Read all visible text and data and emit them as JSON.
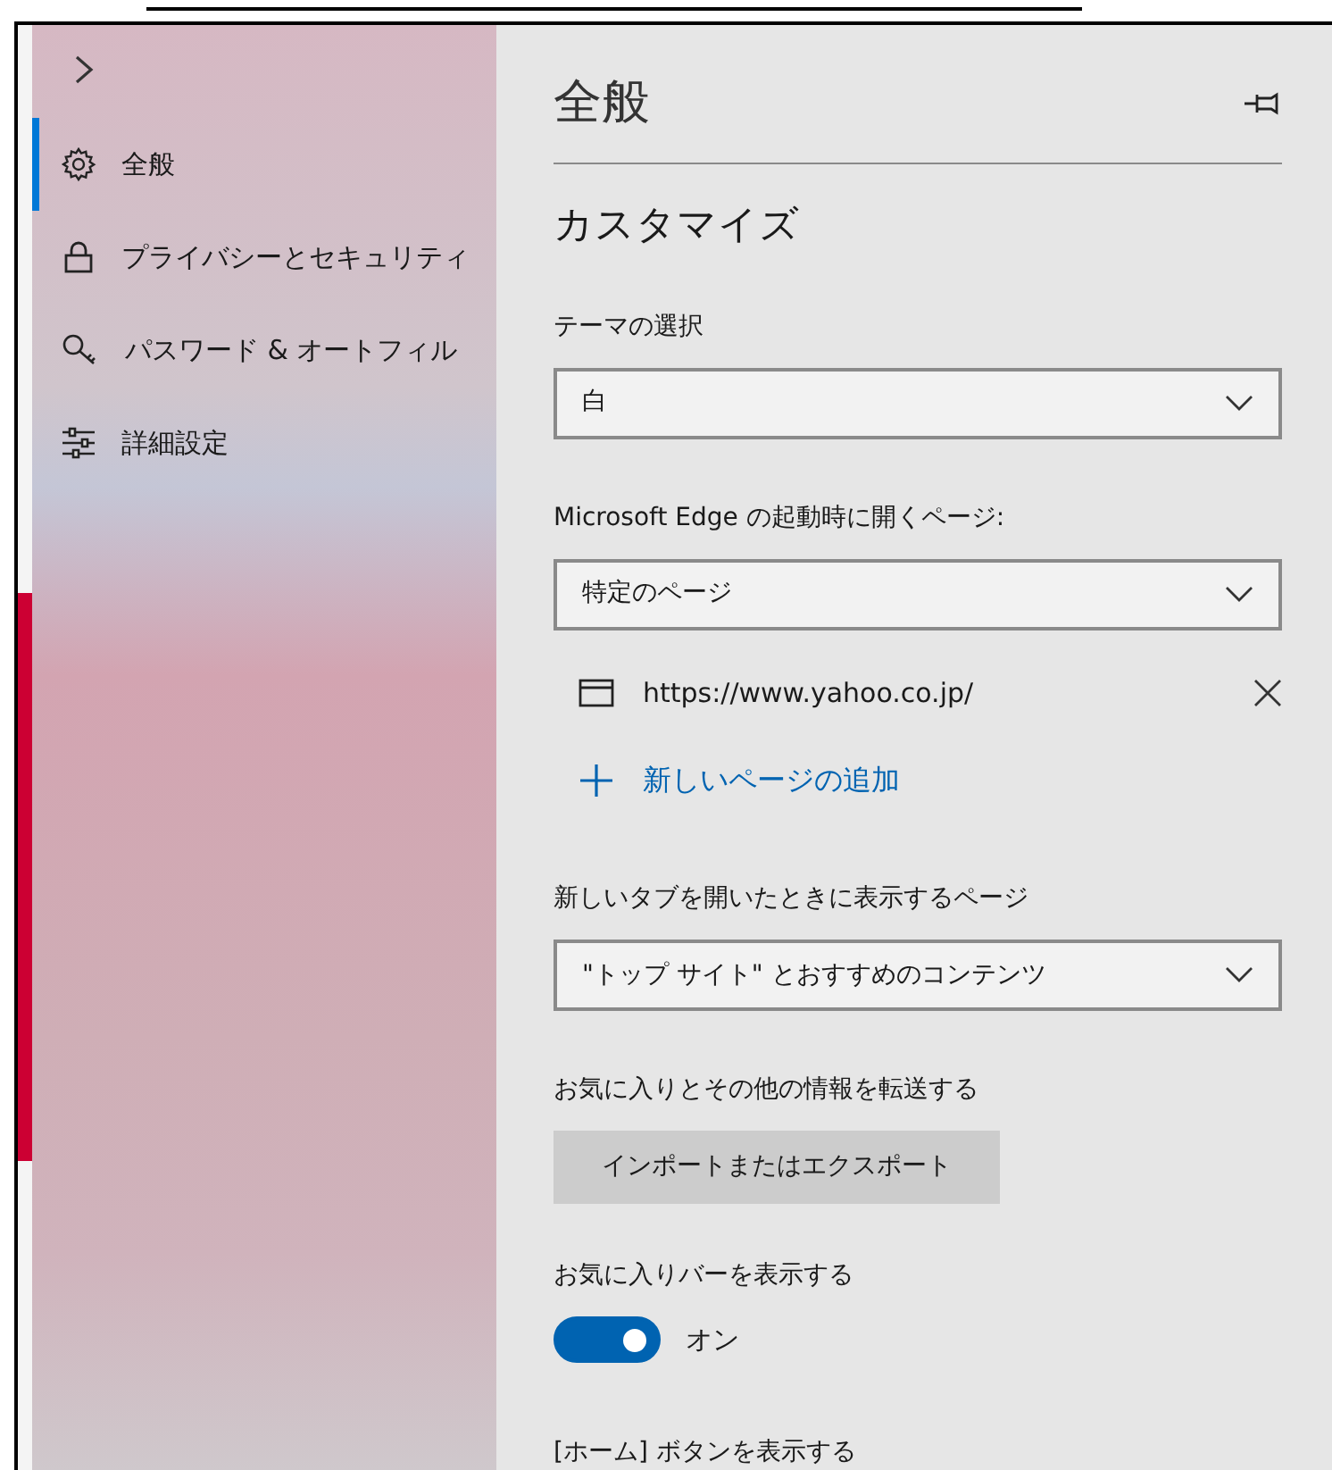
{
  "sidebar": {
    "items": [
      {
        "label": "全般",
        "selected": true
      },
      {
        "label": "プライバシーとセキュリティ",
        "selected": false
      },
      {
        "label": "パスワード & オートフィル",
        "selected": false
      },
      {
        "label": "詳細設定",
        "selected": false
      }
    ]
  },
  "panel": {
    "title": "全般",
    "section": "カスタマイズ",
    "settings": [
      {
        "kind": "dropdown",
        "label": "テーマの選択",
        "value": "白"
      },
      {
        "kind": "dropdown",
        "label": "Microsoft Edge の起動時に開くページ:",
        "value": "特定のページ",
        "pages": [
          {
            "url": "https://www.yahoo.co.jp/"
          }
        ],
        "add_link": "新しいページの追加"
      },
      {
        "kind": "dropdown",
        "label": "新しいタブを開いたときに表示するページ",
        "value": "\"トップ サイト\" とおすすめのコンテンツ"
      },
      {
        "kind": "button",
        "label": "お気に入りとその他の情報を転送する",
        "button": "インポートまたはエクスポート"
      },
      {
        "kind": "toggle",
        "label": "お気に入りバーを表示する",
        "on": true,
        "state_label": "オン"
      },
      {
        "kind": "heading",
        "label": "[ホーム] ボタンを表示する"
      }
    ]
  }
}
